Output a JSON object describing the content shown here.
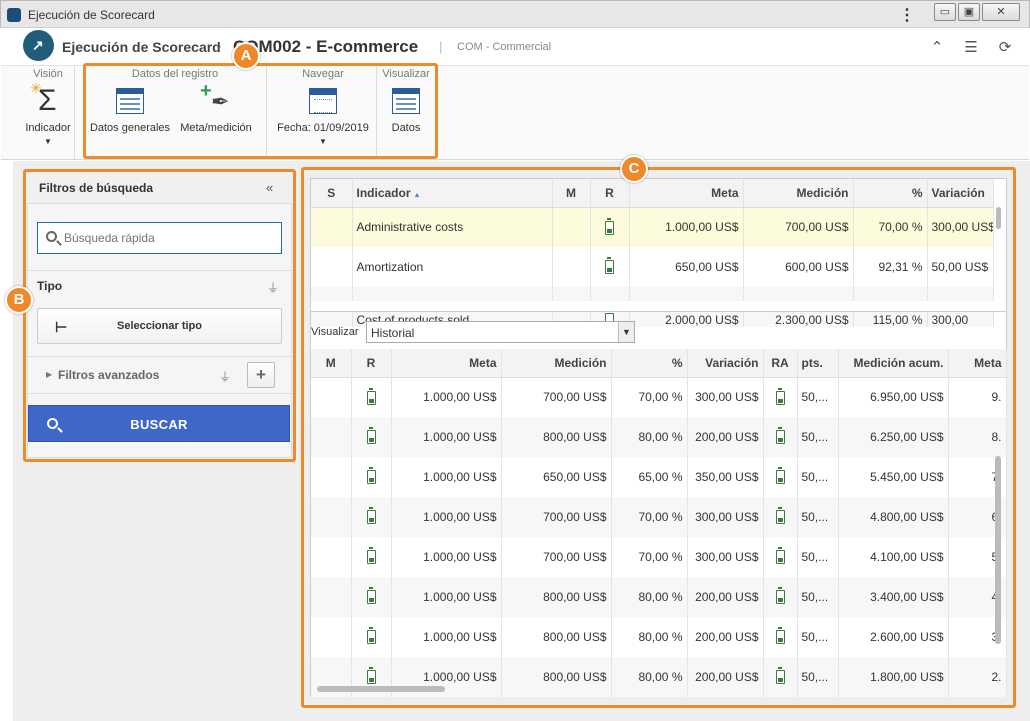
{
  "window": {
    "title": "Ejecución de Scorecard"
  },
  "header": {
    "app": "Ejecución de Scorecard",
    "scorecard": "COM002 - E-commerce",
    "separator": "|",
    "area": "COM - Commercial"
  },
  "toolbar": {
    "groups": {
      "vision": "Visión",
      "registro": "Datos del registro",
      "navegar": "Navegar",
      "visualizar": "Visualizar"
    },
    "indicador": "Indicador",
    "datos_generales": "Datos generales",
    "meta_medicion": "Meta/medición",
    "fecha": "Fecha: 01/09/2019",
    "datos": "Datos"
  },
  "filters": {
    "title": "Filtros de búsqueda",
    "search_placeholder": "Búsqueda rápida",
    "tipo": "Tipo",
    "select_tipo": "Seleccionar tipo",
    "advanced": "Filtros avanzados",
    "buscar": "BUSCAR"
  },
  "indicators": {
    "columns": [
      "S",
      "Indicador",
      "M",
      "R",
      "Meta",
      "Medición",
      "%",
      "Variación"
    ],
    "rows": [
      {
        "name": "Administrative costs",
        "meta": "1.000,00 US$",
        "medicion": "700,00 US$",
        "pct": "70,00 %",
        "var": "300,00 US$"
      },
      {
        "name": "Amortization",
        "meta": "650,00 US$",
        "medicion": "600,00 US$",
        "pct": "92,31 %",
        "var": "50,00 US$"
      },
      {
        "name": "Cost of products sold",
        "meta": "2.000,00 US$",
        "medicion": "2.300,00 US$",
        "pct": "115,00 %",
        "var": "300,00"
      }
    ]
  },
  "visualizar": {
    "label": "Visualizar",
    "value": "Historial"
  },
  "history": {
    "columns": [
      "M",
      "R",
      "Meta",
      "Medición",
      "%",
      "Variación",
      "RA",
      "pts.",
      "Medición acum.",
      "Meta"
    ],
    "rows": [
      {
        "meta": "1.000,00 US$",
        "medicion": "700,00 US$",
        "pct": "70,00 %",
        "var": "300,00 US$",
        "pts": "50,...",
        "acum": "6.950,00 US$",
        "meta2": "9."
      },
      {
        "meta": "1.000,00 US$",
        "medicion": "800,00 US$",
        "pct": "80,00 %",
        "var": "200,00 US$",
        "pts": "50,...",
        "acum": "6.250,00 US$",
        "meta2": "8."
      },
      {
        "meta": "1.000,00 US$",
        "medicion": "650,00 US$",
        "pct": "65,00 %",
        "var": "350,00 US$",
        "pts": "50,...",
        "acum": "5.450,00 US$",
        "meta2": "7."
      },
      {
        "meta": "1.000,00 US$",
        "medicion": "700,00 US$",
        "pct": "70,00 %",
        "var": "300,00 US$",
        "pts": "50,...",
        "acum": "4.800,00 US$",
        "meta2": "6."
      },
      {
        "meta": "1.000,00 US$",
        "medicion": "700,00 US$",
        "pct": "70,00 %",
        "var": "300,00 US$",
        "pts": "50,...",
        "acum": "4.100,00 US$",
        "meta2": "5."
      },
      {
        "meta": "1.000,00 US$",
        "medicion": "800,00 US$",
        "pct": "80,00 %",
        "var": "200,00 US$",
        "pts": "50,...",
        "acum": "3.400,00 US$",
        "meta2": "4."
      },
      {
        "meta": "1.000,00 US$",
        "medicion": "800,00 US$",
        "pct": "80,00 %",
        "var": "200,00 US$",
        "pts": "50,...",
        "acum": "2.600,00 US$",
        "meta2": "3."
      },
      {
        "meta": "1.000,00 US$",
        "medicion": "800,00 US$",
        "pct": "80,00 %",
        "var": "200,00 US$",
        "pts": "50,...",
        "acum": "1.800,00 US$",
        "meta2": "2."
      }
    ]
  },
  "callouts": {
    "a": "A",
    "b": "B",
    "c": "C"
  },
  "colors": {
    "accent": "#ef8829",
    "primary": "#3f67c9",
    "highlight": "#fcfbdc"
  }
}
